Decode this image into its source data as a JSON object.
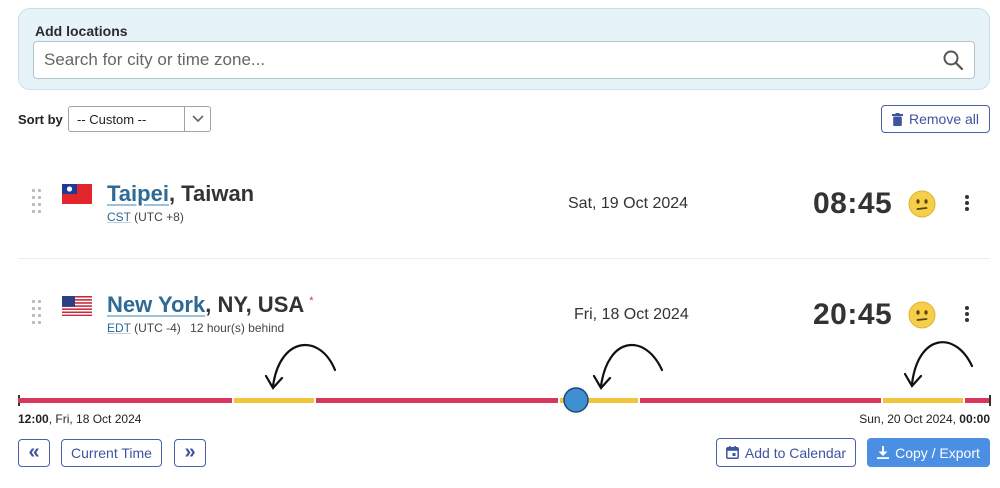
{
  "add_locations": {
    "label": "Add locations",
    "search_placeholder": "Search for city or time zone..."
  },
  "sort": {
    "label": "Sort by",
    "selected": "-- Custom --"
  },
  "remove_all_label": "Remove all",
  "locations": [
    {
      "city": "Taipei",
      "region": ", Taiwan",
      "tz_abbr": "CST",
      "tz_offset": "(UTC +8)",
      "relative": "",
      "date": "Sat, 19 Oct 2024",
      "time": "08:45",
      "flag": "taiwan-flag"
    },
    {
      "city": "New York",
      "region": ", NY, USA",
      "asterisk": "*",
      "tz_abbr": "EDT",
      "tz_offset": "(UTC -4)",
      "relative": "12 hour(s) behind",
      "date": "Fri, 18 Oct 2024",
      "time": "20:45",
      "flag": "usa-flag"
    }
  ],
  "timeline": {
    "start_time": "12:00",
    "start_date": ", Fri, 18 Oct 2024",
    "end_date": "Sun, 20 Oct 2024, ",
    "end_time": "00:00",
    "colors": {
      "busy": "#d8365f",
      "overlap": "#f2c43b",
      "marker": "#3f8fd2"
    }
  },
  "buttons": {
    "prev": "«",
    "current_time": "Current Time",
    "next": "»",
    "add_to_calendar": "Add to Calendar",
    "copy_export": "Copy / Export"
  },
  "colors": {
    "accent": "#4a61a8",
    "primary": "#4a8fe3",
    "link": "#2d6a94",
    "panel": "#e6f3f9"
  }
}
